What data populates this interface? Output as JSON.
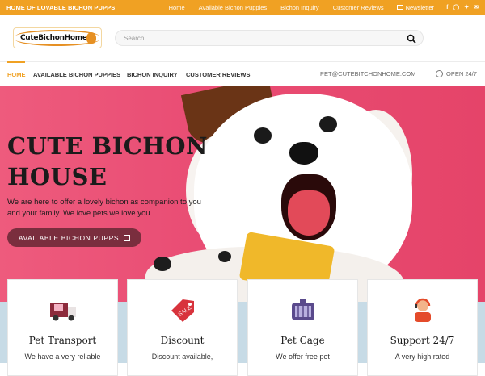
{
  "topbar": {
    "tagline": "HOME OF LOVABLE BICHON PUPPS",
    "links": [
      "Home",
      "Available Bichon Puppies",
      "Bichon Inquiry",
      "Customer Reviews"
    ],
    "newsletter": "Newsletter",
    "social": [
      "f",
      "ig",
      "tw",
      "email"
    ]
  },
  "header": {
    "logo_text": "CuteBichonHome",
    "search_placeholder": "Search..."
  },
  "mainnav": {
    "items": [
      "HOME",
      "AVAILABLE BICHON PUPPIES",
      "BICHON INQUIRY",
      "CUSTOMER REVIEWS"
    ],
    "email": "PET@CUTEBITCHONHOME.COM",
    "hours": "OPEN 24/7"
  },
  "hero": {
    "title_line1": "CUTE BICHON",
    "title_line2": "HOUSE",
    "paragraph": "We are here to offer a lovely bichon as companion to you and your family. We love pets we love you.",
    "cta": "AVAILABLE BICHON PUPPS"
  },
  "features": [
    {
      "title": "Pet Transport",
      "desc": "We have a very reliable",
      "icon": "truck-icon"
    },
    {
      "title": "Discount",
      "desc": "Discount available,",
      "icon": "sale-tag-icon"
    },
    {
      "title": "Pet Cage",
      "desc": "We offer free pet",
      "icon": "pet-cage-icon"
    },
    {
      "title": "Support 24/7",
      "desc": "A very high rated",
      "icon": "support-agent-icon"
    }
  ],
  "colors": {
    "accent": "#f0a123",
    "hero_bg": "#e54b71",
    "cta_bg": "#7a2e3e",
    "band": "#c7dbe6"
  }
}
